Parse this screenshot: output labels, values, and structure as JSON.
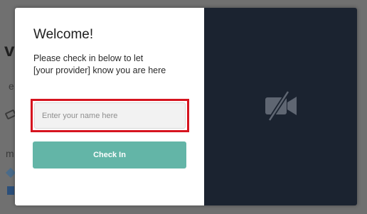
{
  "background": {
    "fragments": [
      "vi",
      "e",
      "m"
    ]
  },
  "modal": {
    "title": "Welcome!",
    "message_lines": [
      "Please check in below to let",
      "[your provider] know you are here"
    ],
    "name_input": {
      "placeholder": "Enter your name here",
      "value": ""
    },
    "checkin_label": "Check In",
    "video_panel": {
      "icon": "camera-off-icon"
    }
  },
  "colors": {
    "accent": "#63b5a7",
    "highlight": "#d6141f",
    "video_bg": "#1b2330",
    "overlay": "#707070"
  }
}
